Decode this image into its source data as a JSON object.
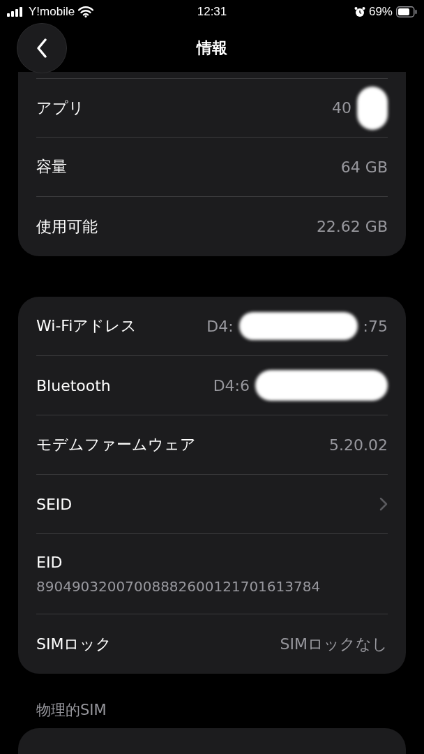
{
  "status_bar": {
    "carrier": "Y!mobile",
    "time": "12:31",
    "battery": "69%"
  },
  "nav": {
    "title": "情報"
  },
  "groups": [
    {
      "cut_top": true,
      "rows": [
        {
          "kind": "value",
          "label": "アプリ",
          "value_parts": [
            "40"
          ],
          "redacted": true
        },
        {
          "kind": "value",
          "label": "容量",
          "value_parts": [
            "64 GB"
          ]
        },
        {
          "kind": "value",
          "label": "使用可能",
          "value_parts": [
            "22.62 GB"
          ]
        }
      ]
    },
    {
      "rows": [
        {
          "kind": "value",
          "label": "Wi-Fiアドレス",
          "value_parts": [
            "D4:",
            ":75"
          ],
          "redacted": true
        },
        {
          "kind": "value",
          "label": "Bluetooth",
          "value_parts": [
            "D4:6"
          ],
          "redacted": true
        },
        {
          "kind": "value",
          "label": "モデムファームウェア",
          "value_parts": [
            "5.20.02"
          ]
        },
        {
          "kind": "link",
          "label": "SEID"
        },
        {
          "kind": "stacked",
          "label": "EID",
          "value_parts": [
            "89049032007008882600121701613784"
          ]
        },
        {
          "kind": "value",
          "label": "SIMロック",
          "value_parts": [
            "SIMロックなし"
          ]
        }
      ]
    },
    {
      "header": "物理的SIM"
    }
  ]
}
